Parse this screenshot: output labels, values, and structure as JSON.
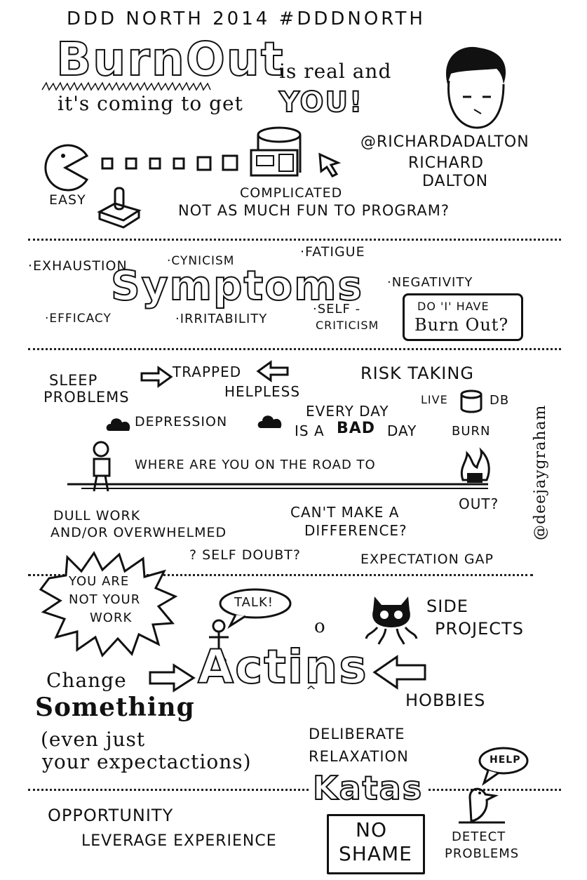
{
  "header": {
    "event": "DDD NORTH 2014 #dddnorth",
    "title_big": "BurnOut",
    "title_rest": "is real and",
    "line2": "it's coming to get",
    "you": "YOU!"
  },
  "speaker": {
    "handle": "@RICHARDADALTON",
    "name_first": "RICHARD",
    "name_last": "DALTON"
  },
  "intro": {
    "easy": "EASY",
    "complicated": "COMPLICATED",
    "question": "NOT AS MUCH FUN TO PROGRAM?"
  },
  "symptoms": {
    "heading": "Symptoms",
    "items": {
      "exhaustion": "·EXHAUSTION",
      "cynicism": "·CYNICISM",
      "fatigue": "·FATIGUE",
      "negativity": "·NEGATIVITY",
      "efficacy": "·EFFICACY",
      "irritability": "·IRRITABILITY",
      "self_line1": "·SELF -",
      "self_line2": "CRITICISM"
    },
    "box_line1": "DO 'I' HAVE",
    "box_line2": "Burn Out?"
  },
  "road": {
    "sleep_line1": "SLEEP",
    "sleep_line2": "PROBLEMS",
    "trapped": "TRAPPED",
    "helpless": "HELPLESS",
    "risk": "RISK TAKING",
    "live": "LIVE",
    "db": "DB",
    "depression": "DEPRESSION",
    "everyday_line1": "EVERY DAY",
    "everyday_line2_a": "IS A",
    "everyday_bad": "BAD",
    "everyday_line2_b": "DAY",
    "burn": "BURN",
    "road_text": "WHERE ARE YOU ON THE ROAD TO",
    "out": "OUT?",
    "credit": "@deejaygraham",
    "dull_line1": "DULL WORK",
    "dull_line2": "AND/OR OVERWHELMED",
    "cant_line1": "CAN'T MAKE A",
    "cant_line2": "DIFFERENCE?",
    "self_doubt": "? SELF DOUBT?",
    "gap": "EXPECTATION GAP"
  },
  "actions": {
    "burst_line1": "YOU ARE",
    "burst_line2": "NOT YOUR",
    "burst_line3": "WORK",
    "talk": "TALK!",
    "side_line1": "SIDE",
    "side_line2": "PROJECTS",
    "heading": "Actins",
    "insert_o": "o",
    "change": "Change",
    "something": "Something",
    "even_line1": "(even just",
    "even_line2": "your expectactions)",
    "hobbies": "HOBBIES",
    "deliberate": "DELIBERATE",
    "relaxation": "RELAXATION",
    "katas": "Katas",
    "help": "HELP"
  },
  "footer": {
    "opportunity": "OPPORTUNITY",
    "leverage": "LEVERAGE EXPERIENCE",
    "no": "NO",
    "shame": "SHAME",
    "detect_line1": "DETECT",
    "detect_line2": "PROBLEMS"
  },
  "icons": [
    "pacman-icon",
    "joystick-icon",
    "server-icon",
    "cursor-icon",
    "face-icon",
    "database-icon",
    "cloud-icon",
    "stick-figure-icon",
    "fire-icon",
    "octocat-icon",
    "bird-icon",
    "speech-bubble-icon",
    "arrow-icon"
  ],
  "colors": {
    "ink": "#111111",
    "paper": "#ffffff"
  }
}
